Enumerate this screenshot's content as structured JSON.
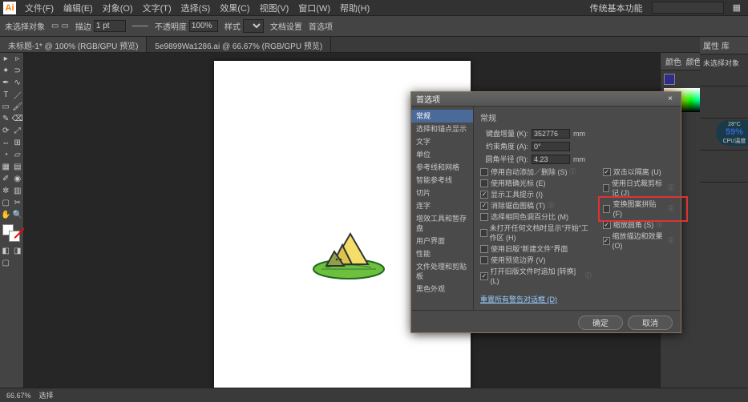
{
  "menubar": {
    "items": [
      "文件(F)",
      "编辑(E)",
      "对象(O)",
      "文字(T)",
      "选择(S)",
      "效果(C)",
      "视图(V)",
      "窗口(W)",
      "帮助(H)"
    ],
    "rightLabel": "传统基本功能",
    "searchPlaceholder": ""
  },
  "optbar": {
    "noSel": "未选择对象",
    "strokeLabel": "描边",
    "strokeVal": "1 pt",
    "styleLabel": "样式",
    "opacityLabel": "不透明度",
    "opacityVal": "100%",
    "docSetup": "文档设置",
    "prefs": "首选项"
  },
  "tabs": [
    {
      "label": "未标题-1* @ 100% (RGB/GPU 预览)",
      "active": true
    },
    {
      "label": "5e9899Wa1286.ai @ 66.67% (RGB/GPU 预览)",
      "active": false
    }
  ],
  "panels": {
    "colorTitle": "颜色",
    "colorGuideTitle": "颜色参考",
    "hex": "2F2D8A",
    "propsTitle": "属性",
    "libsTitle": "库",
    "noSel": "未选择对象"
  },
  "perf": {
    "pct": "59%",
    "label": "CPU温度",
    "temp": "28°C"
  },
  "dialog": {
    "title": "首选项",
    "nav": [
      "常规",
      "选择和锚点显示",
      "文字",
      "单位",
      "参考线和网格",
      "智能参考线",
      "切片",
      "连字",
      "增效工具和暂存盘",
      "用户界面",
      "性能",
      "文件处理和剪贴板",
      "黑色外观"
    ],
    "section": "常规",
    "kbIncLabel": "键盘增量 (K):",
    "kbIncVal": "352776",
    "kbIncUnit": "mm",
    "angleLabel": "约束角度 (A):",
    "angleVal": "0°",
    "radiusLabel": "圆角半径 (R):",
    "radiusVal": "4.23",
    "radiusUnit": "mm",
    "left": [
      {
        "t": "停用自动添加／删除 (S)",
        "c": false,
        "i": true
      },
      {
        "t": "使用精确光标 (E)",
        "c": false
      },
      {
        "t": "显示工具提示 (I)",
        "c": true
      },
      {
        "t": "消除锯齿图稿 (T)",
        "c": true,
        "i": true
      },
      {
        "t": "选择相同色调百分比 (M)",
        "c": false
      },
      {
        "t": "未打开任何文档时显示\"开始\"工作区 (H)",
        "c": false
      },
      {
        "t": "使用旧版\"新建文件\"界面",
        "c": false
      },
      {
        "t": "使用预览边界 (V)",
        "c": false
      },
      {
        "t": "打开旧版文件时追加 [转换] (L)",
        "c": true,
        "i": true
      }
    ],
    "right": [
      {
        "t": "双击以隔离 (U)",
        "c": true
      },
      {
        "t": "使用日式裁剪标记 (J)",
        "c": false,
        "i": true
      },
      {
        "t": "变换图案拼贴 (F)",
        "c": false,
        "i": true
      },
      {
        "t": "缩放圆角 (S)",
        "c": true,
        "i": true
      },
      {
        "t": "缩放描边和效果 (O)",
        "c": true,
        "i": true
      }
    ],
    "reset": "重置所有警告对话框 (D)",
    "ok": "确定",
    "cancel": "取消"
  },
  "status": {
    "zoom": "66.67%",
    "sel": "选择"
  }
}
